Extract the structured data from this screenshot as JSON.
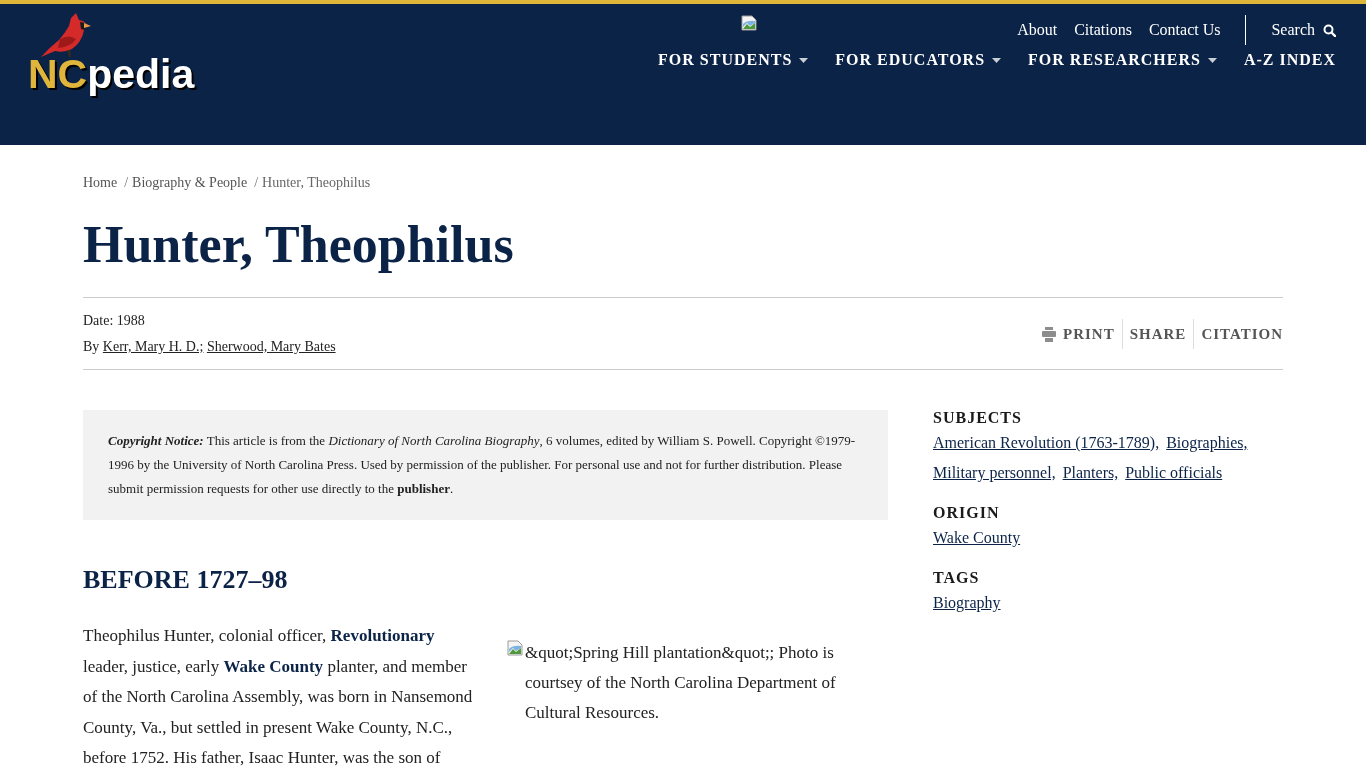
{
  "header": {
    "logo": {
      "prefix": "NC",
      "suffix": "pedia"
    },
    "utility_links": [
      "About",
      "Citations",
      "Contact Us"
    ],
    "search": {
      "label": "Search"
    },
    "nav": [
      {
        "label": "FOR STUDENTS",
        "has_dropdown": true
      },
      {
        "label": "FOR EDUCATORS",
        "has_dropdown": true
      },
      {
        "label": "FOR RESEARCHERS",
        "has_dropdown": true
      },
      {
        "label": "A-Z INDEX",
        "has_dropdown": false
      }
    ]
  },
  "breadcrumb": {
    "items": [
      {
        "label": "Home"
      },
      {
        "separator": "/",
        "label": "Biography & People"
      },
      {
        "separator": "/",
        "label": "Hunter, Theophilus"
      }
    ]
  },
  "article": {
    "title": "Hunter, Theophilus",
    "date": "Date: 1988",
    "byline": {
      "prefix": "By",
      "authors": [
        "Kerr, Mary H. D.;",
        "Sherwood, Mary Bates"
      ]
    },
    "actions": [
      {
        "label": "PRINT",
        "kind": "print"
      },
      {
        "label": "SHARE",
        "kind": "text"
      },
      {
        "label": "CITATION",
        "kind": "text"
      }
    ],
    "copyright": {
      "label": "Copyright Notice:",
      "text": "This article is from the *Dictionary of North Carolina Biography*, 6 volumes, edited by William S. Powell. Copyright ©1979-1996 by the University of North Carolina Press. Used by permission of the publisher. For personal use and not for further distribution. Please submit permission requests for other use directly to the **publisher**."
    },
    "section": {
      "heading": "BEFORE 1727–98",
      "paragraph": "Theophilus Hunter, colonial officer, **Revolutionary** leader, justice, early **Wake County** planter, and member of the North Carolina Assembly, was born in Nansemond County, Va., but settled in present Wake County, N.C., before 1752. His father, Isaac Hunter, was the son of",
      "figure": {
        "caption": "&quot;Spring Hill plantation&quot;; Photo is courtsey of the North Carolina Department of Cultural Resources."
      }
    }
  },
  "sidebar": [
    {
      "heading": "SUBJECTS",
      "links": [
        "American Revolution (1763-1789),",
        "Biographies,",
        "Military personnel,",
        "Planters,",
        "Public officials"
      ]
    },
    {
      "heading": "ORIGIN",
      "links": [
        "Wake County"
      ]
    },
    {
      "heading": "TAGS",
      "links": [
        "Biography"
      ]
    }
  ]
}
